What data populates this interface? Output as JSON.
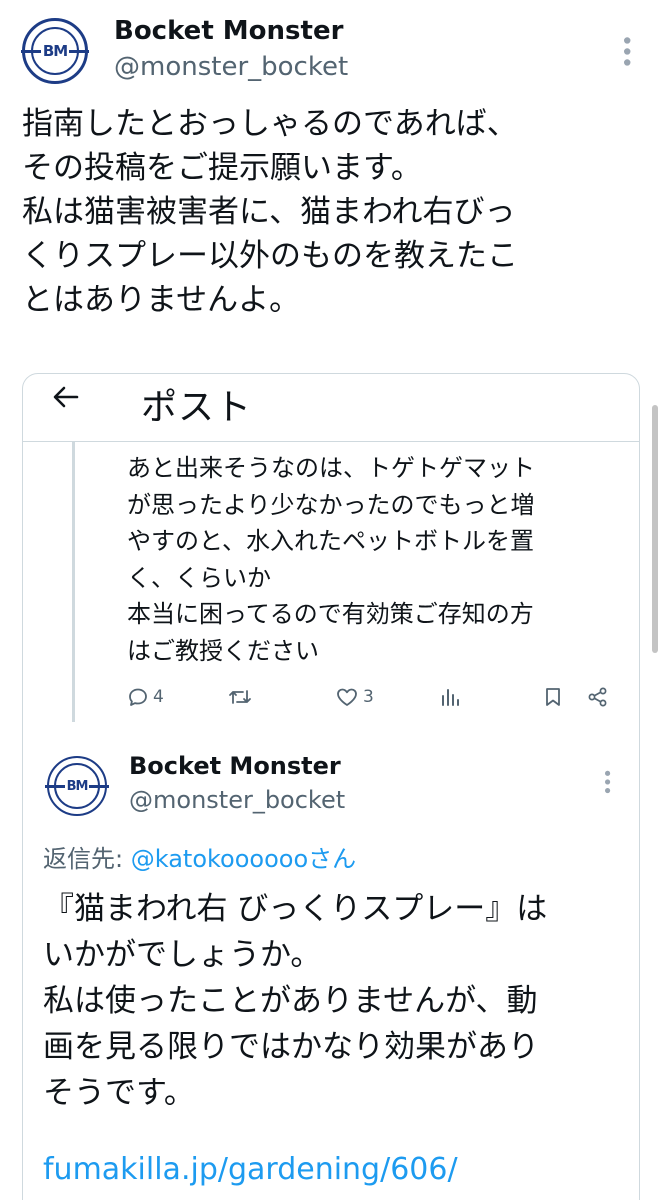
{
  "author": {
    "name": "Bocket Monster",
    "handle": "@monster_bocket",
    "avatar_text": "BM"
  },
  "post": {
    "lines": [
      "指南したとおっしゃるのであれば、",
      "その投稿をご提示願います。",
      "私は猫害被害者に、猫まわれ右びっ",
      "くりスプレー以外のものを教えたこ",
      "とはありませんよ。"
    ]
  },
  "embedded": {
    "nav_title": "ポスト",
    "parent_lines": [
      "あと出来そうなのは、トゲトゲマット",
      "が思ったより少なかったのでもっと増",
      "やすのと、水入れたペットボトルを置",
      "く、くらいか",
      "本当に困ってるので有効策ご存知の方",
      "はご教授ください"
    ],
    "actions": {
      "reply_count": "4",
      "retweet_count": "",
      "like_count": "3"
    },
    "reply": {
      "name": "Bocket Monster",
      "handle": "@monster_bocket",
      "replying_prefix": "返信先: ",
      "replying_mention": "@katokoooooo",
      "replying_suffix": "さん",
      "lines": [
        "『猫まわれ右 びっくりスプレー』は",
        "いかがでしょうか。",
        "私は使ったことがありませんが、動",
        "画を見る限りではかなり効果があり",
        "そうです。"
      ],
      "link": "fumakilla.jp/gardening/606/"
    }
  },
  "colors": {
    "link": "#1d9bf0",
    "secondary_text": "#536471",
    "avatar_navy": "#1d3c86",
    "border": "#cfd9de"
  }
}
